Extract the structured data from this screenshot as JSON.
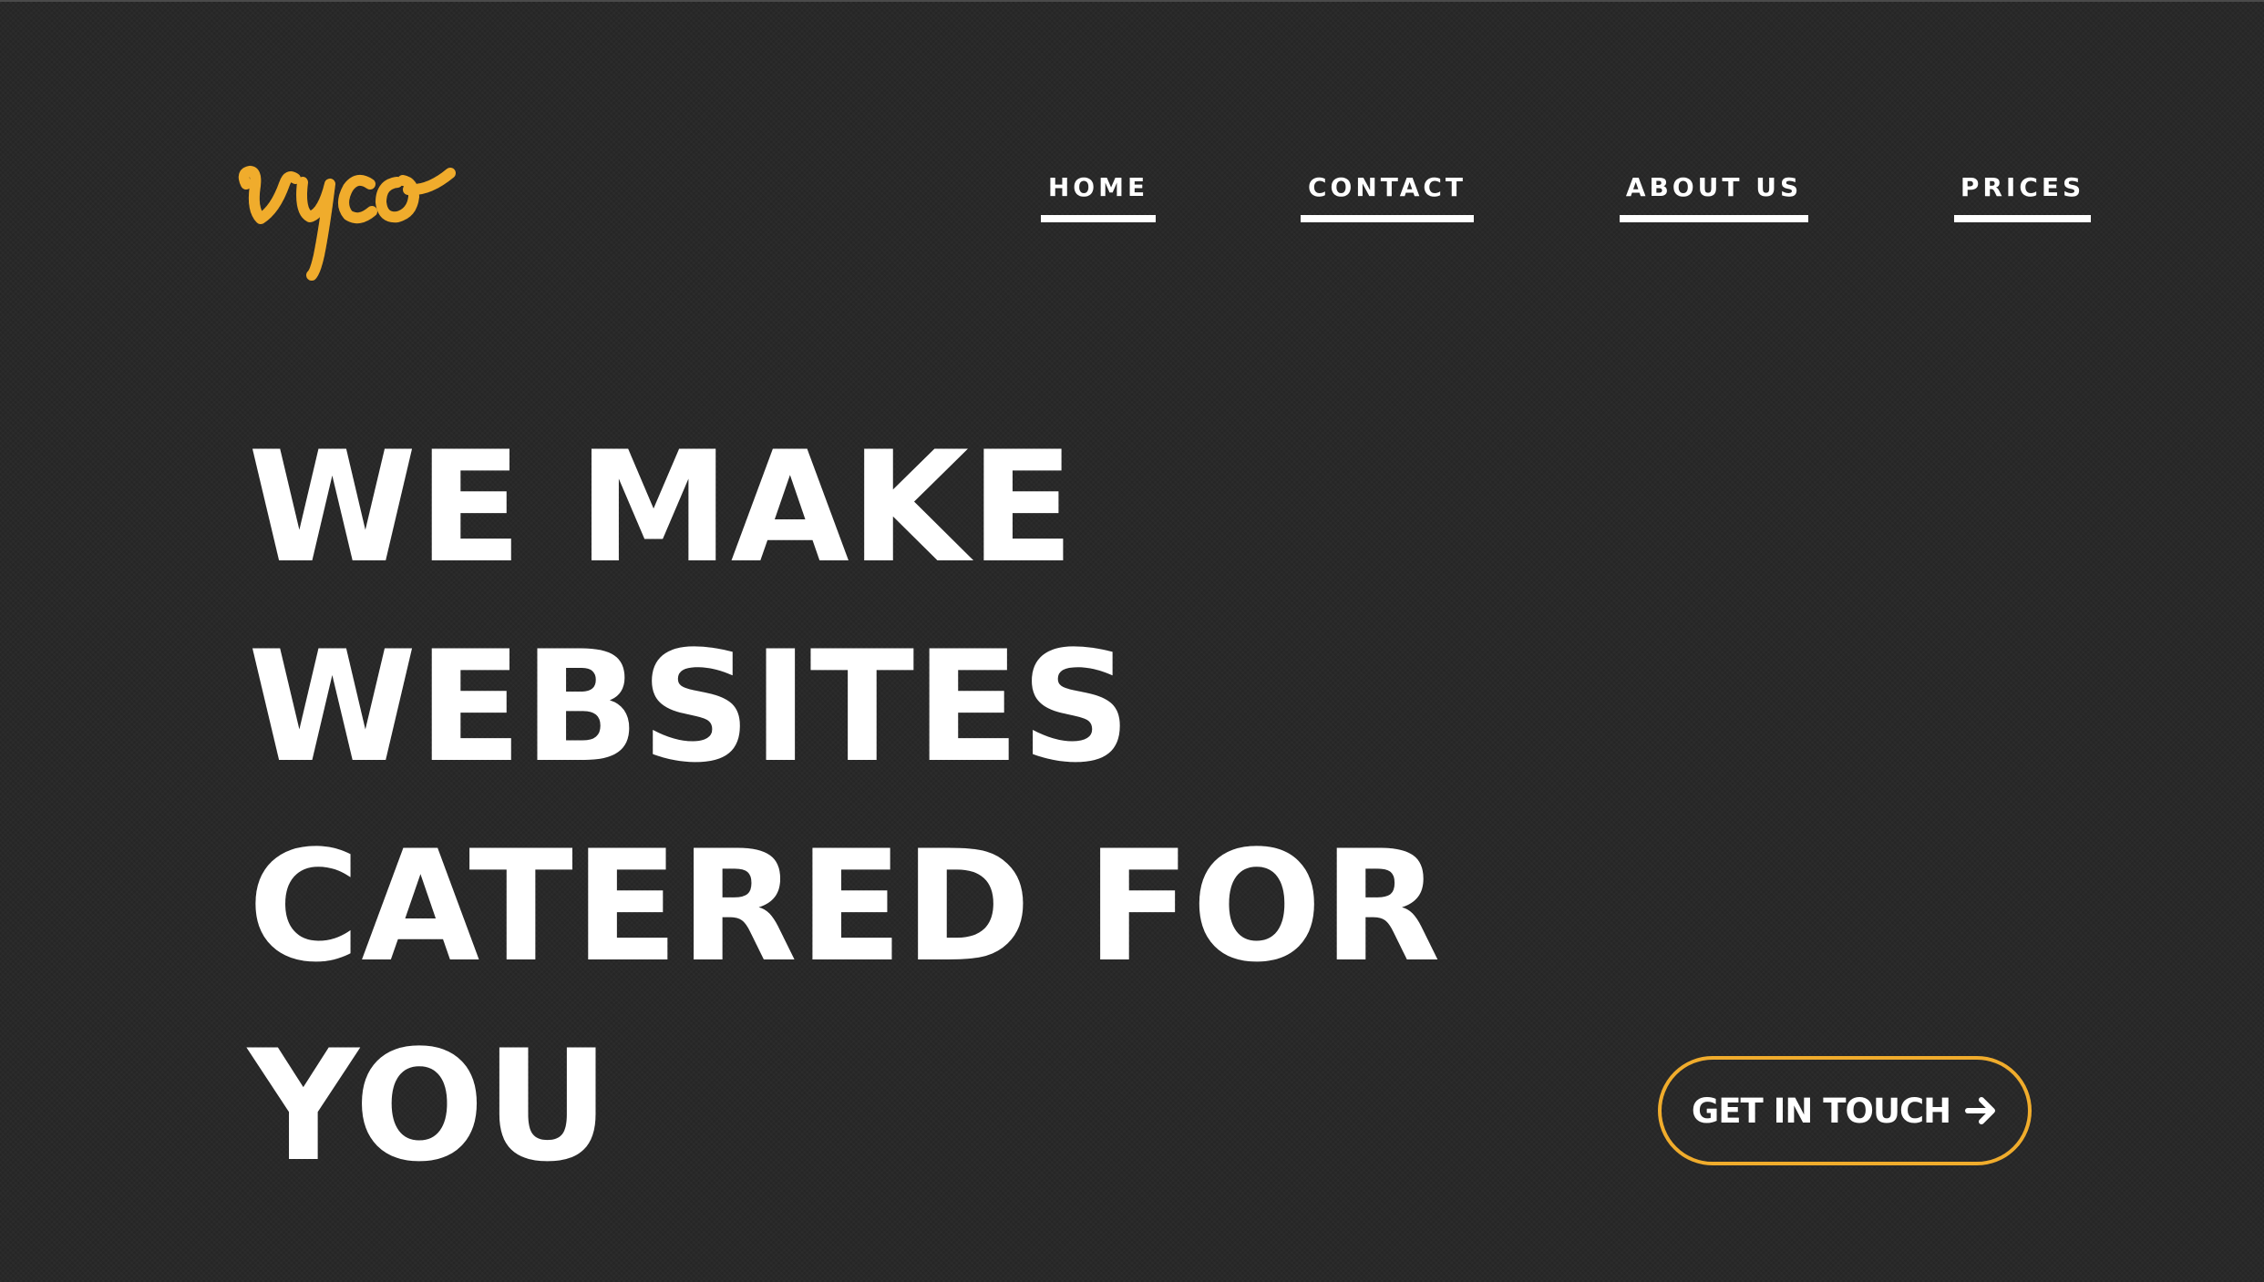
{
  "brand": {
    "logo_text": "vyco",
    "accent_color": "#f0ac2c"
  },
  "nav": {
    "items": [
      {
        "label": "HOME"
      },
      {
        "label": "CONTACT"
      },
      {
        "label": "ABOUT US"
      },
      {
        "label": "PRICES"
      }
    ]
  },
  "hero": {
    "lines": [
      "WE MAKE",
      "WEBSITES",
      "CATERED FOR",
      "YOU"
    ]
  },
  "cta": {
    "label": "GET IN TOUCH",
    "icon": "arrow-right-icon",
    "border_color": "#f0ac2c"
  },
  "theme": {
    "background": "#272727",
    "text": "#ffffff"
  }
}
